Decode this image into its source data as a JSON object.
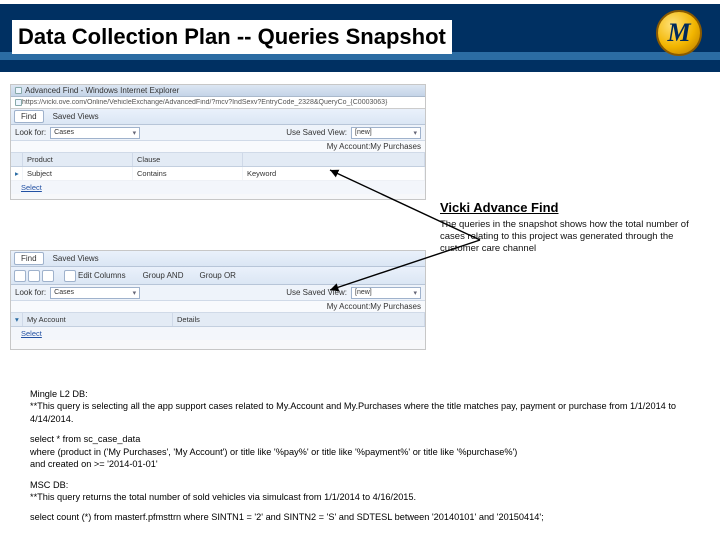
{
  "title": "Data Collection Plan -- Queries Snapshot",
  "logo_letter": "M",
  "shot1": {
    "win_title": "Advanced Find - Windows Internet Explorer",
    "url": "https://vicki.ove.com/Online/VehicleExchange/AdvancedFind/?mcv?IndSexv?EntryCode_2328&QueryCo_{C0003063}",
    "tabs": [
      "Find",
      "Saved Views"
    ],
    "lookfor_label": "Look for:",
    "lookfor_value": "Cases",
    "usesaved_label": "Use Saved View:",
    "usesaved_value": "[new]",
    "columns": [
      "",
      "Product",
      "Clause",
      ""
    ],
    "row": {
      "col0": "▸",
      "col1": "Subject",
      "col2": "Contains",
      "col3": "Keyword"
    },
    "select": "Select",
    "account": "My Account:My Purchases"
  },
  "shot2": {
    "tabs": [
      "Find",
      "Saved Views"
    ],
    "tool_labels": [
      "Group AND",
      "Group OR"
    ],
    "edit_cols": "Edit Columns",
    "lookfor_label": "Look for:",
    "lookfor_value": "Cases",
    "usesaved_label": "Use Saved View:",
    "usesaved_value": "[new]",
    "account": "My Account:My Purchases",
    "details_left": "My Account",
    "details_right": "Details",
    "select": "Select"
  },
  "annotation": {
    "heading": "Vicki Advance Find",
    "body": "The queries in the snapshot shows how the total number of cases relating to this project was generated through the customer care channel"
  },
  "copy": {
    "p1": "Mingle L2 DB:",
    "p2": "**This query is selecting all the app support cases related to My.Account and My.Purchases where the title matches pay, payment or purchase from 1/1/2014 to 4/14/2014.",
    "p3": "select * from sc_case_data",
    "p4": "where (product in ('My Purchases', 'My Account') or title like '%pay%' or title like '%payment%' or title like '%purchase%')",
    "p5": "and created on >= '2014-01-01'",
    "p6": "MSC DB:",
    "p7": "**This query returns the total number of sold vehicles via simulcast from 1/1/2014 to 4/16/2015.",
    "p8": "select count (*) from masterf.pfmsttrn where SINTN1 = '2' and SINTN2 = 'S' and SDTESL between '20140101' and '20150414';"
  }
}
